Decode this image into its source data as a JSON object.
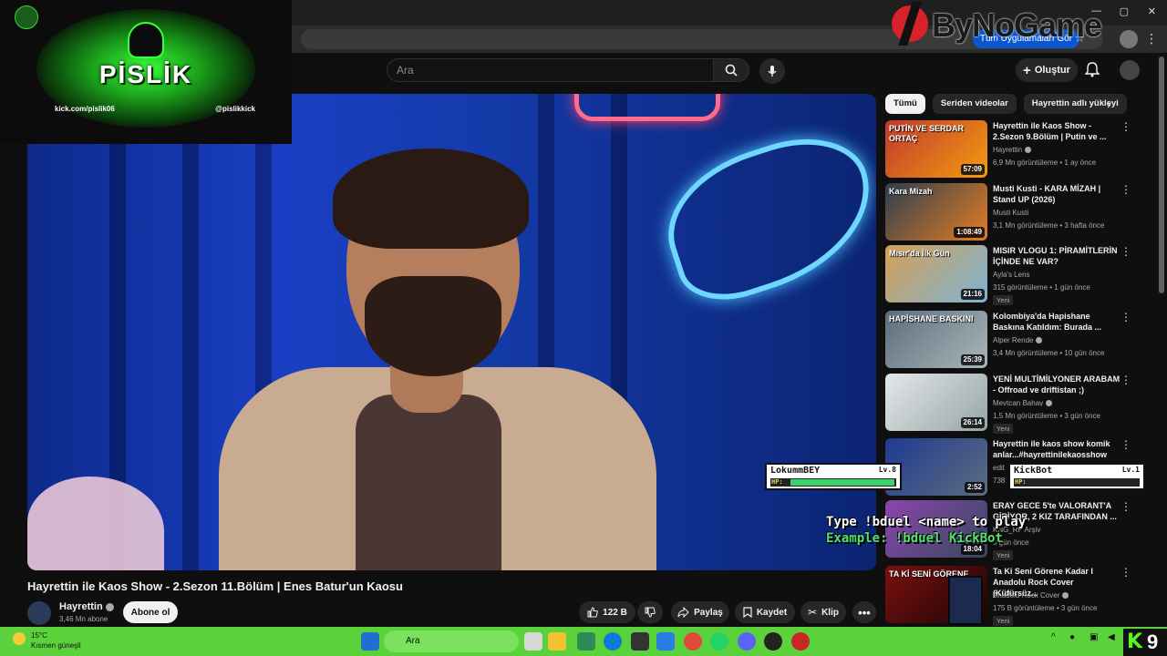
{
  "overlay": {
    "title": "PİSLİK",
    "kick_link": "kick.com/pislik06",
    "instagram": "@pislikkick"
  },
  "brand_watermark": "ByNoGame",
  "browser": {
    "chip_label": "Tüm Uygulamaları Gör"
  },
  "header": {
    "search_placeholder": "Ara",
    "create_label": "Oluştur"
  },
  "video": {
    "title": "Hayrettin ile Kaos Show - 2.Sezon 11.Bölüm | Enes Batur'un Kaosu",
    "channel": "Hayrettin",
    "subscribers": "3,46 Mn abone",
    "subscribe_label": "Abone ol",
    "likes": "122 B",
    "share_label": "Paylaş",
    "save_label": "Kaydet",
    "clip_label": "Klip"
  },
  "chips": [
    "Tümü",
    "Seriden videolar",
    "Hayrettin adlı yükleyi"
  ],
  "sidebar": [
    {
      "title": "Hayrettin ile Kaos Show - 2.Sezon 9.Bölüm | Putin ve ...",
      "channel": "Hayrettin",
      "verified": true,
      "meta": "6,9 Mn görüntüleme • 1 ay önce",
      "duration": "57:09",
      "thumb_text": "PUTİN VE SERDAR ORTAÇ",
      "badge": "",
      "colors": [
        "#c0392b",
        "#f39c12"
      ]
    },
    {
      "title": "Musti Kusti - KARA MİZAH  | Stand UP (2026)",
      "channel": "Musti Kusti",
      "verified": false,
      "meta": "3,1 Mn görüntüleme • 3 hafta önce",
      "duration": "1:08:49",
      "thumb_text": "Kara Mizah",
      "badge": "",
      "colors": [
        "#2c3e50",
        "#e67e22"
      ]
    },
    {
      "title": "MISIR VLOGU 1: PİRAMİTLERİN İÇİNDE NE VAR?",
      "channel": "Ayla's Lens",
      "verified": false,
      "meta": "315 görüntüleme • 1 gün önce",
      "duration": "21:16",
      "thumb_text": "Mısır'da İlk Gün",
      "badge": "Yeni",
      "colors": [
        "#d4a056",
        "#7fb3d5"
      ]
    },
    {
      "title": "Kolombiya'da Hapishane Baskına Katıldım: Burada ...",
      "channel": "Alper Rende",
      "verified": true,
      "meta": "3,4 Mn görüntüleme • 10 gün önce",
      "duration": "25:39",
      "thumb_text": "HAPİSHANE BASKINI",
      "badge": "",
      "colors": [
        "#5d6d7e",
        "#aab7b8"
      ]
    },
    {
      "title": "YENİ MULTİMİLYONER ARABAM - Offroad ve driftistan ;)",
      "channel": "Mevtcan Bahav",
      "verified": true,
      "meta": "1,5 Mn görüntüleme • 3 gün önce",
      "duration": "26:14",
      "thumb_text": "",
      "badge": "Yeni",
      "colors": [
        "#e5e7e9",
        "#95a5a6"
      ]
    },
    {
      "title": "Hayrettin ile kaos show komik anlar...#hayrettinilekaosshow",
      "channel": "edit",
      "verified": false,
      "meta": "738",
      "duration": "2:52",
      "thumb_text": "",
      "badge": "",
      "colors": [
        "#1f3a93",
        "#5d6d7e"
      ]
    },
    {
      "title": "ERAY GECE 5'te VALORANT'A GİRİYOR, 2 KIZ TARAFINDAN ...",
      "channel": "KNG_RP Arşiv",
      "verified": false,
      "meta": "3 gün önce",
      "duration": "18:04",
      "thumb_text": "",
      "badge": "Yeni",
      "colors": [
        "#8e44ad",
        "#34495e"
      ]
    },
    {
      "title": "Ta Ki Seni Görene Kadar l Anadolu Rock Cover (Küfürsüz...",
      "channel": "Anadolu Rock Cover",
      "verified": true,
      "meta": "175 B görüntüleme • 3 gün önce",
      "duration": "",
      "thumb_text": "TA Kİ SENİ GÖRENE",
      "badge": "Yeni",
      "colors": [
        "#7b1010",
        "#1a0505"
      ]
    }
  ],
  "game": {
    "player1_name": "LokummBEY",
    "player1_level": "Lv.8",
    "player1_hp": 0.97,
    "player2_name": "KickBot",
    "player2_level": "Lv.1",
    "player2_hp": 0.0,
    "hp_label": "HP:",
    "instruction": "Type !bduel <name> to play",
    "example": "Example: !bduel KickBot"
  },
  "taskbar": {
    "weather_temp": "15°C",
    "weather_desc": "Kısmen güneşli",
    "search_label": "Ara",
    "kick_count": "9"
  },
  "colors": {
    "accent_green": "#53fc18",
    "taskbar_green": "#5bd23c",
    "youtube_bg": "#0f0f0f"
  }
}
